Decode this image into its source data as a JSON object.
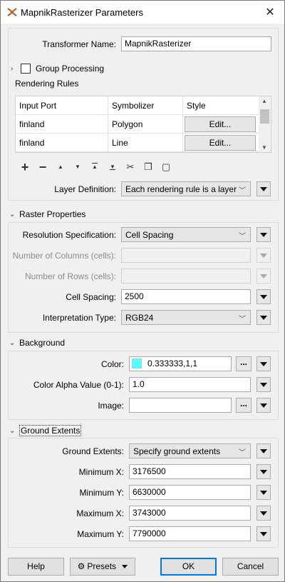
{
  "window": {
    "title": "MapnikRasterizer Parameters",
    "close_glyph": "✕"
  },
  "transformer": {
    "label": "Transformer Name:",
    "value": "MapnikRasterizer"
  },
  "group_processing": {
    "label": "Group Processing",
    "checked": false
  },
  "rendering_rules": {
    "title": "Rendering Rules",
    "columns": [
      "Input Port",
      "Symbolizer",
      "Style"
    ],
    "rows": [
      {
        "input_port": "finland",
        "symbolizer": "Polygon",
        "style": "Edit..."
      },
      {
        "input_port": "finland",
        "symbolizer": "Line",
        "style": "Edit..."
      }
    ],
    "toolbar_icons": [
      "add-icon",
      "remove-icon",
      "move-up-icon",
      "move-down-icon",
      "move-top-icon",
      "move-bottom-icon",
      "cut-icon",
      "copy-icon",
      "paste-icon"
    ]
  },
  "layer_definition": {
    "label": "Layer Definition:",
    "value": "Each rendering rule is a layer"
  },
  "raster_properties": {
    "title": "Raster Properties",
    "resolution": {
      "label": "Resolution Specification:",
      "value": "Cell Spacing"
    },
    "columns": {
      "label": "Number of Columns (cells):",
      "value": ""
    },
    "rows": {
      "label": "Number of Rows (cells):",
      "value": ""
    },
    "cell_spacing": {
      "label": "Cell Spacing:",
      "value": "2500"
    },
    "interpretation": {
      "label": "Interpretation Type:",
      "value": "RGB24"
    }
  },
  "background": {
    "title": "Background",
    "color": {
      "label": "Color:",
      "value": "0.333333,1,1",
      "swatch": "#55ffff"
    },
    "alpha": {
      "label": "Color Alpha Value (0-1):",
      "value": "1.0"
    },
    "image": {
      "label": "Image:",
      "value": ""
    },
    "dots": "..."
  },
  "ground_extents": {
    "title": "Ground Extents",
    "mode": {
      "label": "Ground Extents:",
      "value": "Specify ground extents"
    },
    "min_x": {
      "label": "Minimum X:",
      "value": "3176500"
    },
    "min_y": {
      "label": "Minimum Y:",
      "value": "6630000"
    },
    "max_x": {
      "label": "Maximum X:",
      "value": "3743000"
    },
    "max_y": {
      "label": "Maximum Y:",
      "value": "7790000"
    }
  },
  "footer": {
    "help": "Help",
    "presets": "Presets",
    "ok": "OK",
    "cancel": "Cancel"
  },
  "colors": {
    "accent": "#0078d7",
    "window_bg": "#f0f0f0"
  }
}
